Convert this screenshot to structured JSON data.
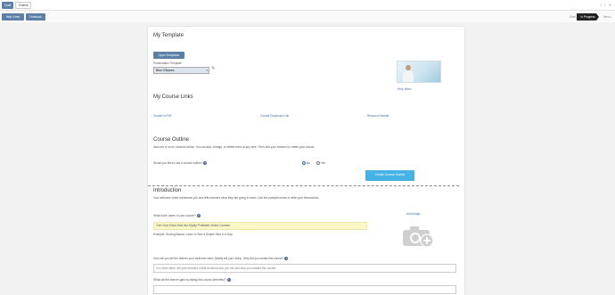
{
  "tabs": {
    "active": "Draft",
    "other": "Outline"
  },
  "toolbar": {
    "help_video": "Help Video",
    "feedback": "Feedback"
  },
  "status": {
    "draft": "Draft",
    "in_progress": "In Progress",
    "next": "Next ▸"
  },
  "template": {
    "heading": "My Template",
    "open_button": "Open Templates",
    "presentation_label": "Presentation Template",
    "selected": "Blue Ellipses",
    "help_video_label": "Help Video"
  },
  "course_links": {
    "heading": "My Course Links",
    "pdf": "Course in PDF",
    "download": "Course Download Link",
    "bundle": "Resource Bundle"
  },
  "outline": {
    "heading": "Course Outline",
    "description": "Add one or more Lessons below. You can add, change, or delete them at any time. Then add your lessons to create your course.",
    "question": "Would you like to use a course outline?",
    "no": "No",
    "yes": "Yes",
    "create_button": "Create Course Outline"
  },
  "introduction": {
    "heading": "Introduction",
    "description": "Your welcome video introduces you and tells learners what they are going to learn. Use the prompts below to write your introduction.",
    "name_label": "What is the name of your course?",
    "name_value": "Turn Your Know-How into Highly Profitable Online Courses",
    "name_hint": "Example: Sewing Basics: Learn to Sew a Simple Skirt in a Day",
    "add_image": "Add Image",
    "ideal_label": "How will you tell the learner your welcome video (briefly tell your story). Why did you create this course?",
    "ideal_placeholder": "In a short video, tell your learners a little bit about who you are and why you created this course.",
    "benefit_label": "What will the learner gain by taking this course (benefits)?"
  },
  "icons": {
    "edit": "edit-icon",
    "question": "question-icon",
    "camera": "camera-add-icon",
    "window": "window-icon"
  }
}
